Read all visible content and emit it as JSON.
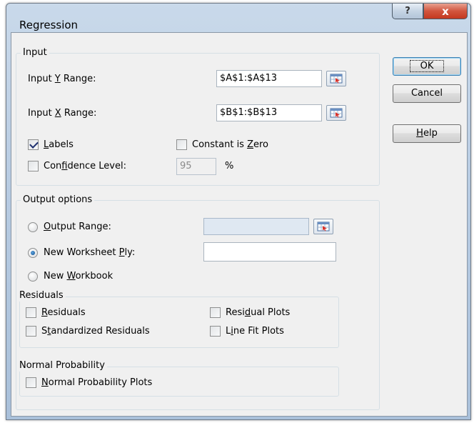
{
  "window": {
    "title": "Regression",
    "help_glyph": "?",
    "close_glyph": "x"
  },
  "buttons": {
    "ok": "OK",
    "cancel": "Cancel",
    "help_pre": "",
    "help_mn": "H",
    "help_post": "elp"
  },
  "input": {
    "legend": "Input",
    "y_pre": "Input ",
    "y_mn": "Y",
    "y_post": " Range:",
    "y_value": "$A$1:$A$13",
    "x_pre": "Input ",
    "x_mn": "X",
    "x_post": " Range:",
    "x_value": "$B$1:$B$13",
    "labels_pre": "",
    "labels_mn": "L",
    "labels_post": "abels",
    "labels_checked": true,
    "constant_pre": "Constant is ",
    "constant_mn": "Z",
    "constant_post": "ero",
    "constant_checked": false,
    "confidence_pre": "Con",
    "confidence_mn": "f",
    "confidence_post": "idence Level:",
    "confidence_checked": false,
    "confidence_value": "95",
    "percent": "%"
  },
  "output": {
    "legend": "Output options",
    "range_pre": "",
    "range_mn": "O",
    "range_post": "utput Range:",
    "range_value": "",
    "range_selected": false,
    "ply_pre": "New Worksheet ",
    "ply_mn": "P",
    "ply_post": "ly:",
    "ply_value": "",
    "ply_selected": true,
    "workbook_pre": "New ",
    "workbook_mn": "W",
    "workbook_post": "orkbook",
    "workbook_selected": false
  },
  "residuals": {
    "legend": "Residuals",
    "residuals_pre": "",
    "residuals_mn": "R",
    "residuals_post": "esiduals",
    "standardized_pre": "S",
    "standardized_mn": "t",
    "standardized_post": "andardized Residuals",
    "plots_pre": "Resi",
    "plots_mn": "d",
    "plots_post": "ual Plots",
    "linefit_pre": "L",
    "linefit_mn": "i",
    "linefit_post": "ne Fit Plots"
  },
  "normal": {
    "legend": "Normal Probability",
    "plots_pre": "",
    "plots_mn": "N",
    "plots_post": "ormal Probability Plots"
  },
  "colors": {
    "accent": "#3c7fb1",
    "close": "#c4381f",
    "face": "#f0f0f0"
  },
  "icons": {
    "range_picker": "collapse-dialog-icon",
    "help": "help-icon",
    "close": "close-icon"
  }
}
